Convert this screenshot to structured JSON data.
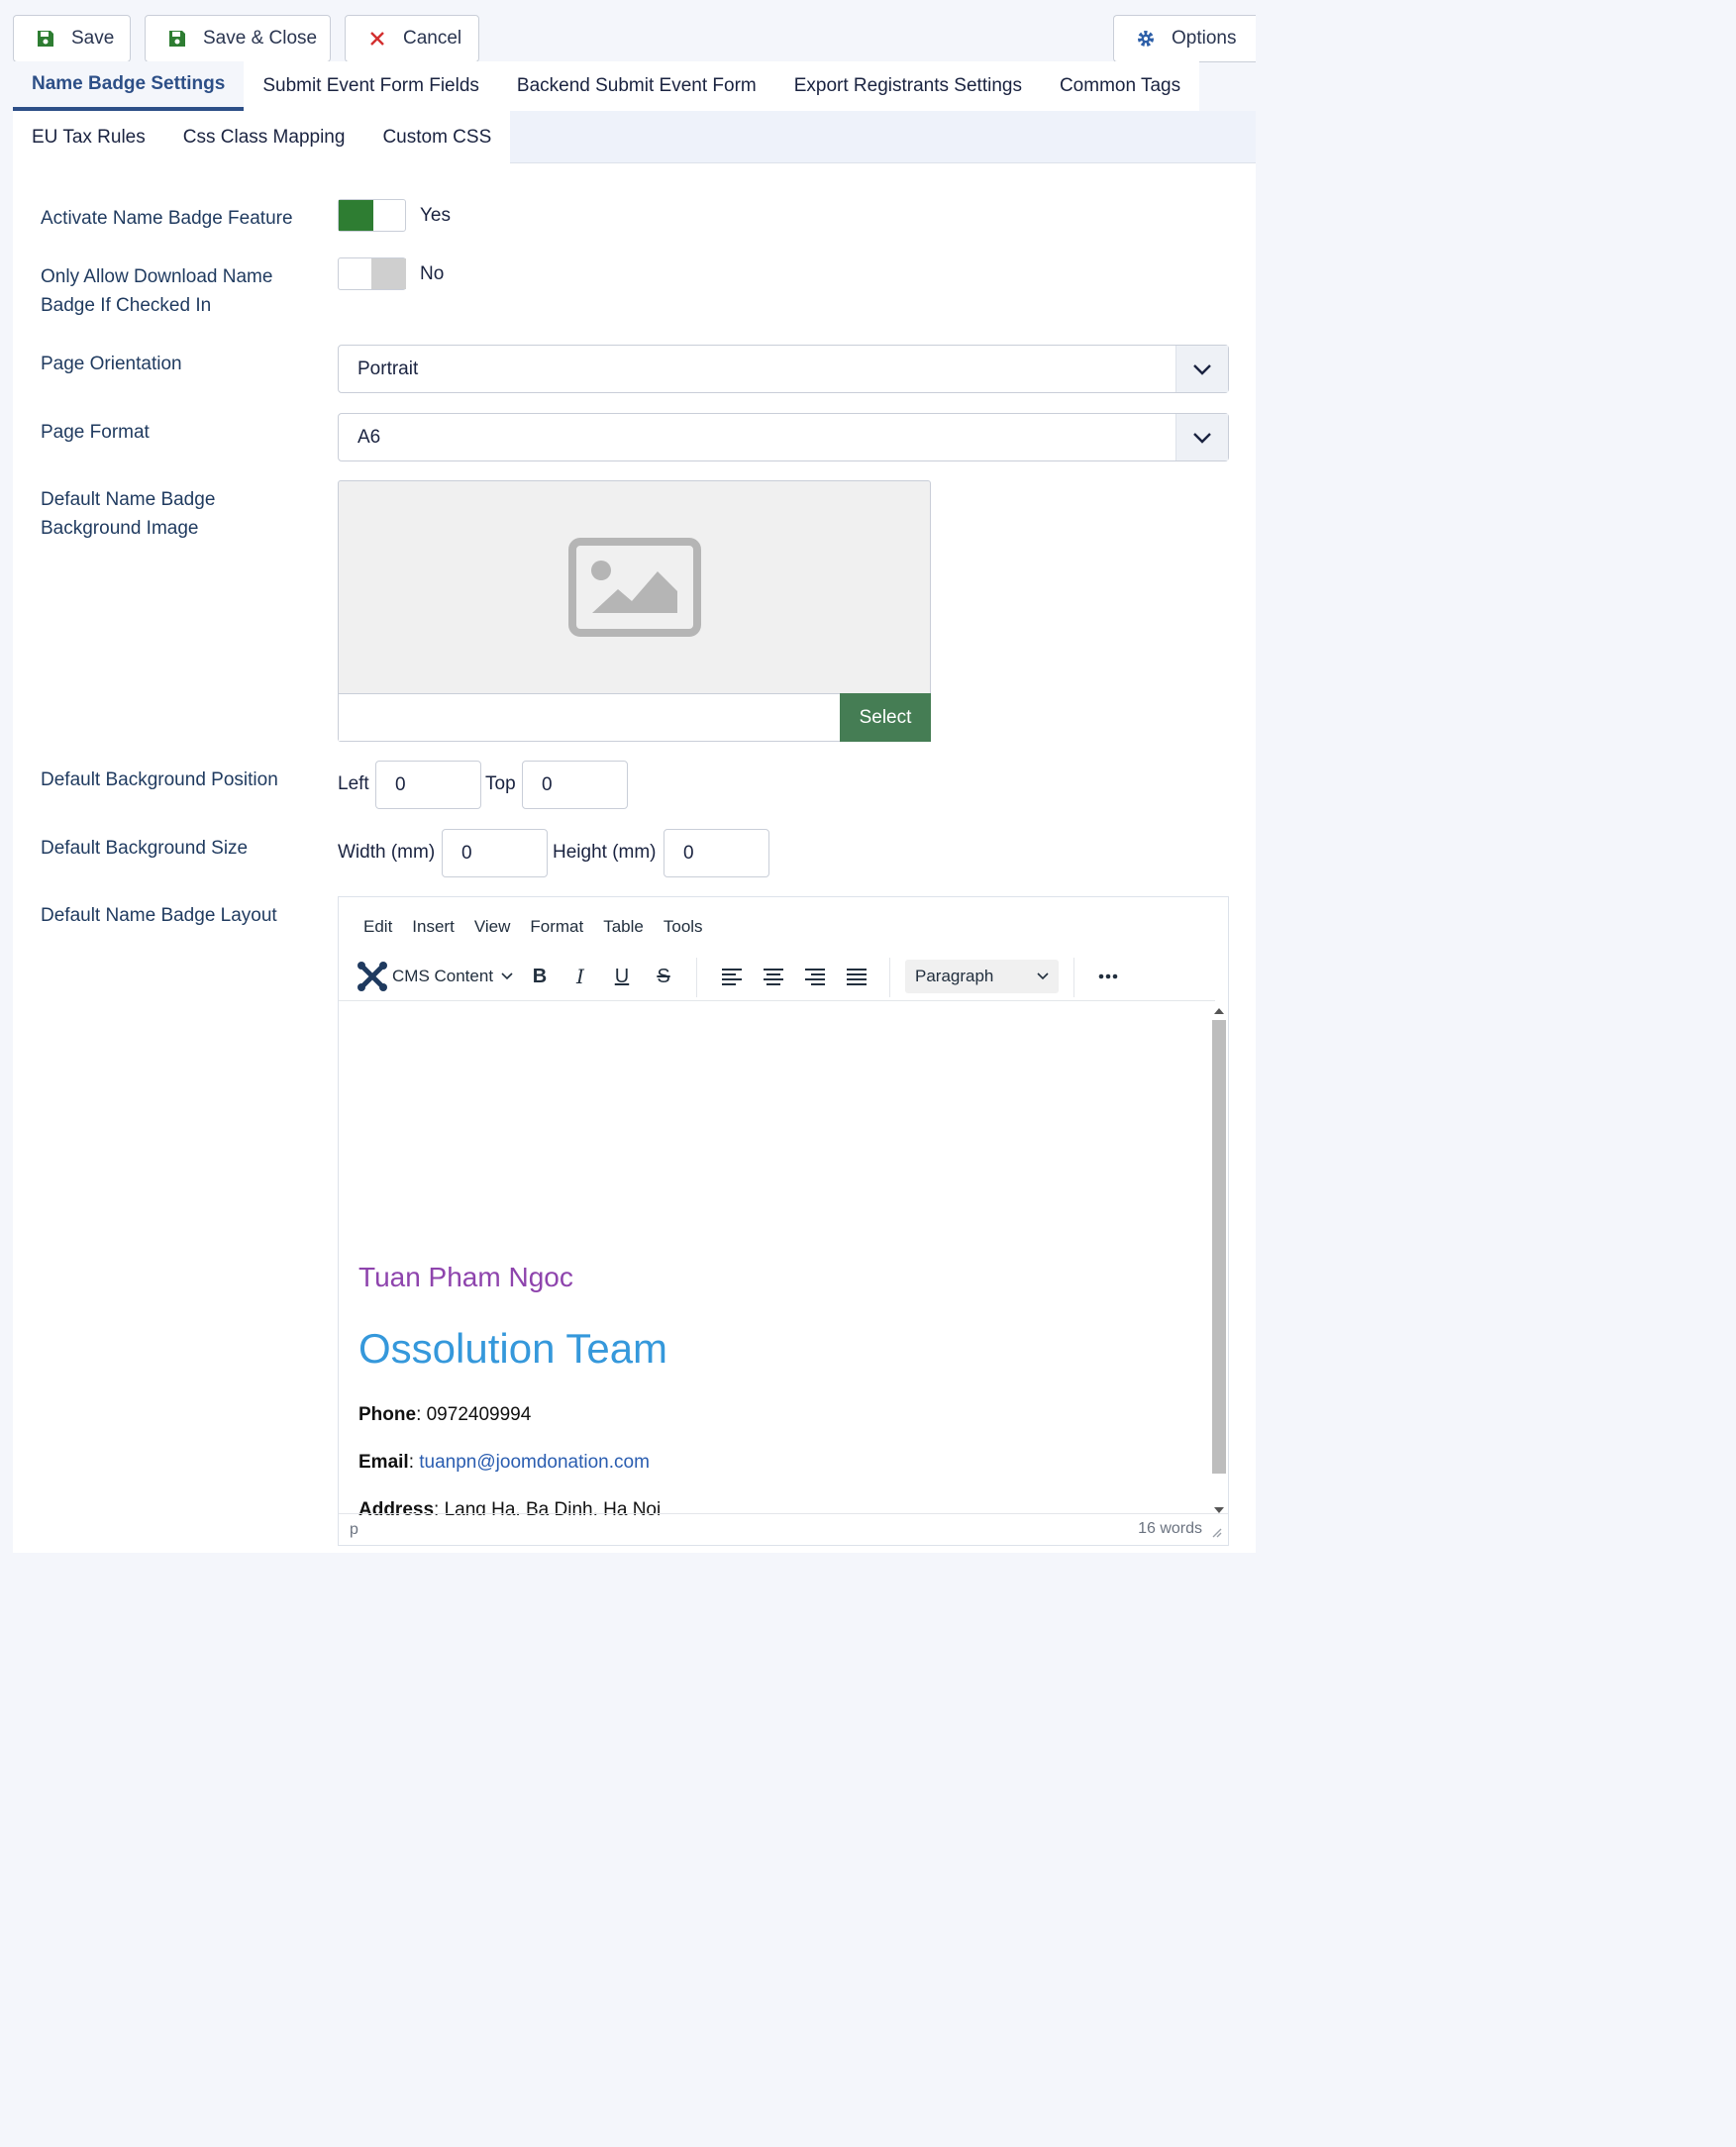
{
  "toolbar": {
    "save": "Save",
    "save_close": "Save & Close",
    "cancel": "Cancel",
    "options": "Options"
  },
  "tabs": {
    "row1": [
      "Name Badge Settings",
      "Submit Event Form Fields",
      "Backend Submit Event Form",
      "Export Registrants Settings",
      "Common Tags"
    ],
    "row2": [
      "EU Tax Rules",
      "Css Class Mapping",
      "Custom CSS"
    ],
    "active": "Name Badge Settings"
  },
  "form": {
    "activate_label": "Activate Name Badge Feature",
    "activate_value": "Yes",
    "only_allow_label_1": "Only Allow Download Name",
    "only_allow_label_2": "Badge If Checked In",
    "only_allow_value": "No",
    "orientation_label": "Page Orientation",
    "orientation_value": "Portrait",
    "format_label": "Page Format",
    "format_value": "A6",
    "bg_image_label_1": "Default Name Badge",
    "bg_image_label_2": "Background Image",
    "bg_image_select": "Select",
    "bg_position_label": "Default Background Position",
    "left_label": "Left",
    "left_value": "0",
    "top_label": "Top",
    "top_value": "0",
    "bg_size_label": "Default Background Size",
    "width_label": "Width (mm)",
    "width_value": "0",
    "height_label": "Height (mm)",
    "height_value": "0",
    "layout_label": "Default Name Badge Layout"
  },
  "editor": {
    "menu": [
      "Edit",
      "Insert",
      "View",
      "Format",
      "Table",
      "Tools"
    ],
    "cms_content": "CMS Content",
    "block_format": "Paragraph",
    "content": {
      "name": "Tuan Pham Ngoc",
      "team": "Ossolution Team",
      "phone_label": "Phone",
      "phone_value": ": 0972409994",
      "email_label": "Email",
      "email_value": "tuanpn@joomdonation.com",
      "address_label": "Address",
      "address_value": ": Lang Ha, Ba Dinh, Ha Noi"
    },
    "status_path": "p",
    "word_count": "16 words"
  },
  "colors": {
    "accent": "#2d4f87",
    "switch_on": "#2e7d32",
    "select_button": "#457d54",
    "name_color": "#8e44ad",
    "team_color": "#3598db",
    "link_color": "#2a5db0"
  }
}
